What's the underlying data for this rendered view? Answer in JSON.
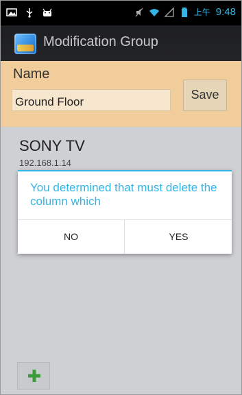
{
  "status_bar": {
    "time_prefix": "上午",
    "time": "9:48",
    "icons": [
      "image-icon",
      "usb-icon",
      "android-debug-icon",
      "mute-icon",
      "wifi-icon",
      "signal-icon",
      "battery-icon"
    ]
  },
  "action_bar": {
    "title": "Modification Group",
    "icon": "app-icon"
  },
  "form": {
    "name_label": "Name",
    "name_value": "Ground Floor",
    "save_label": "Save"
  },
  "devices": [
    {
      "name": "SONY TV",
      "ip": "192.168.1.14"
    }
  ],
  "dialog": {
    "message": "You determined that must delete the column which",
    "no_label": "NO",
    "yes_label": "YES"
  },
  "footer": {
    "add_icon": "plus-icon"
  },
  "colors": {
    "accent": "#33b5e5",
    "panel": "#f0cd9b",
    "background": "#cfd0d3",
    "plus": "#3c9b3c"
  }
}
